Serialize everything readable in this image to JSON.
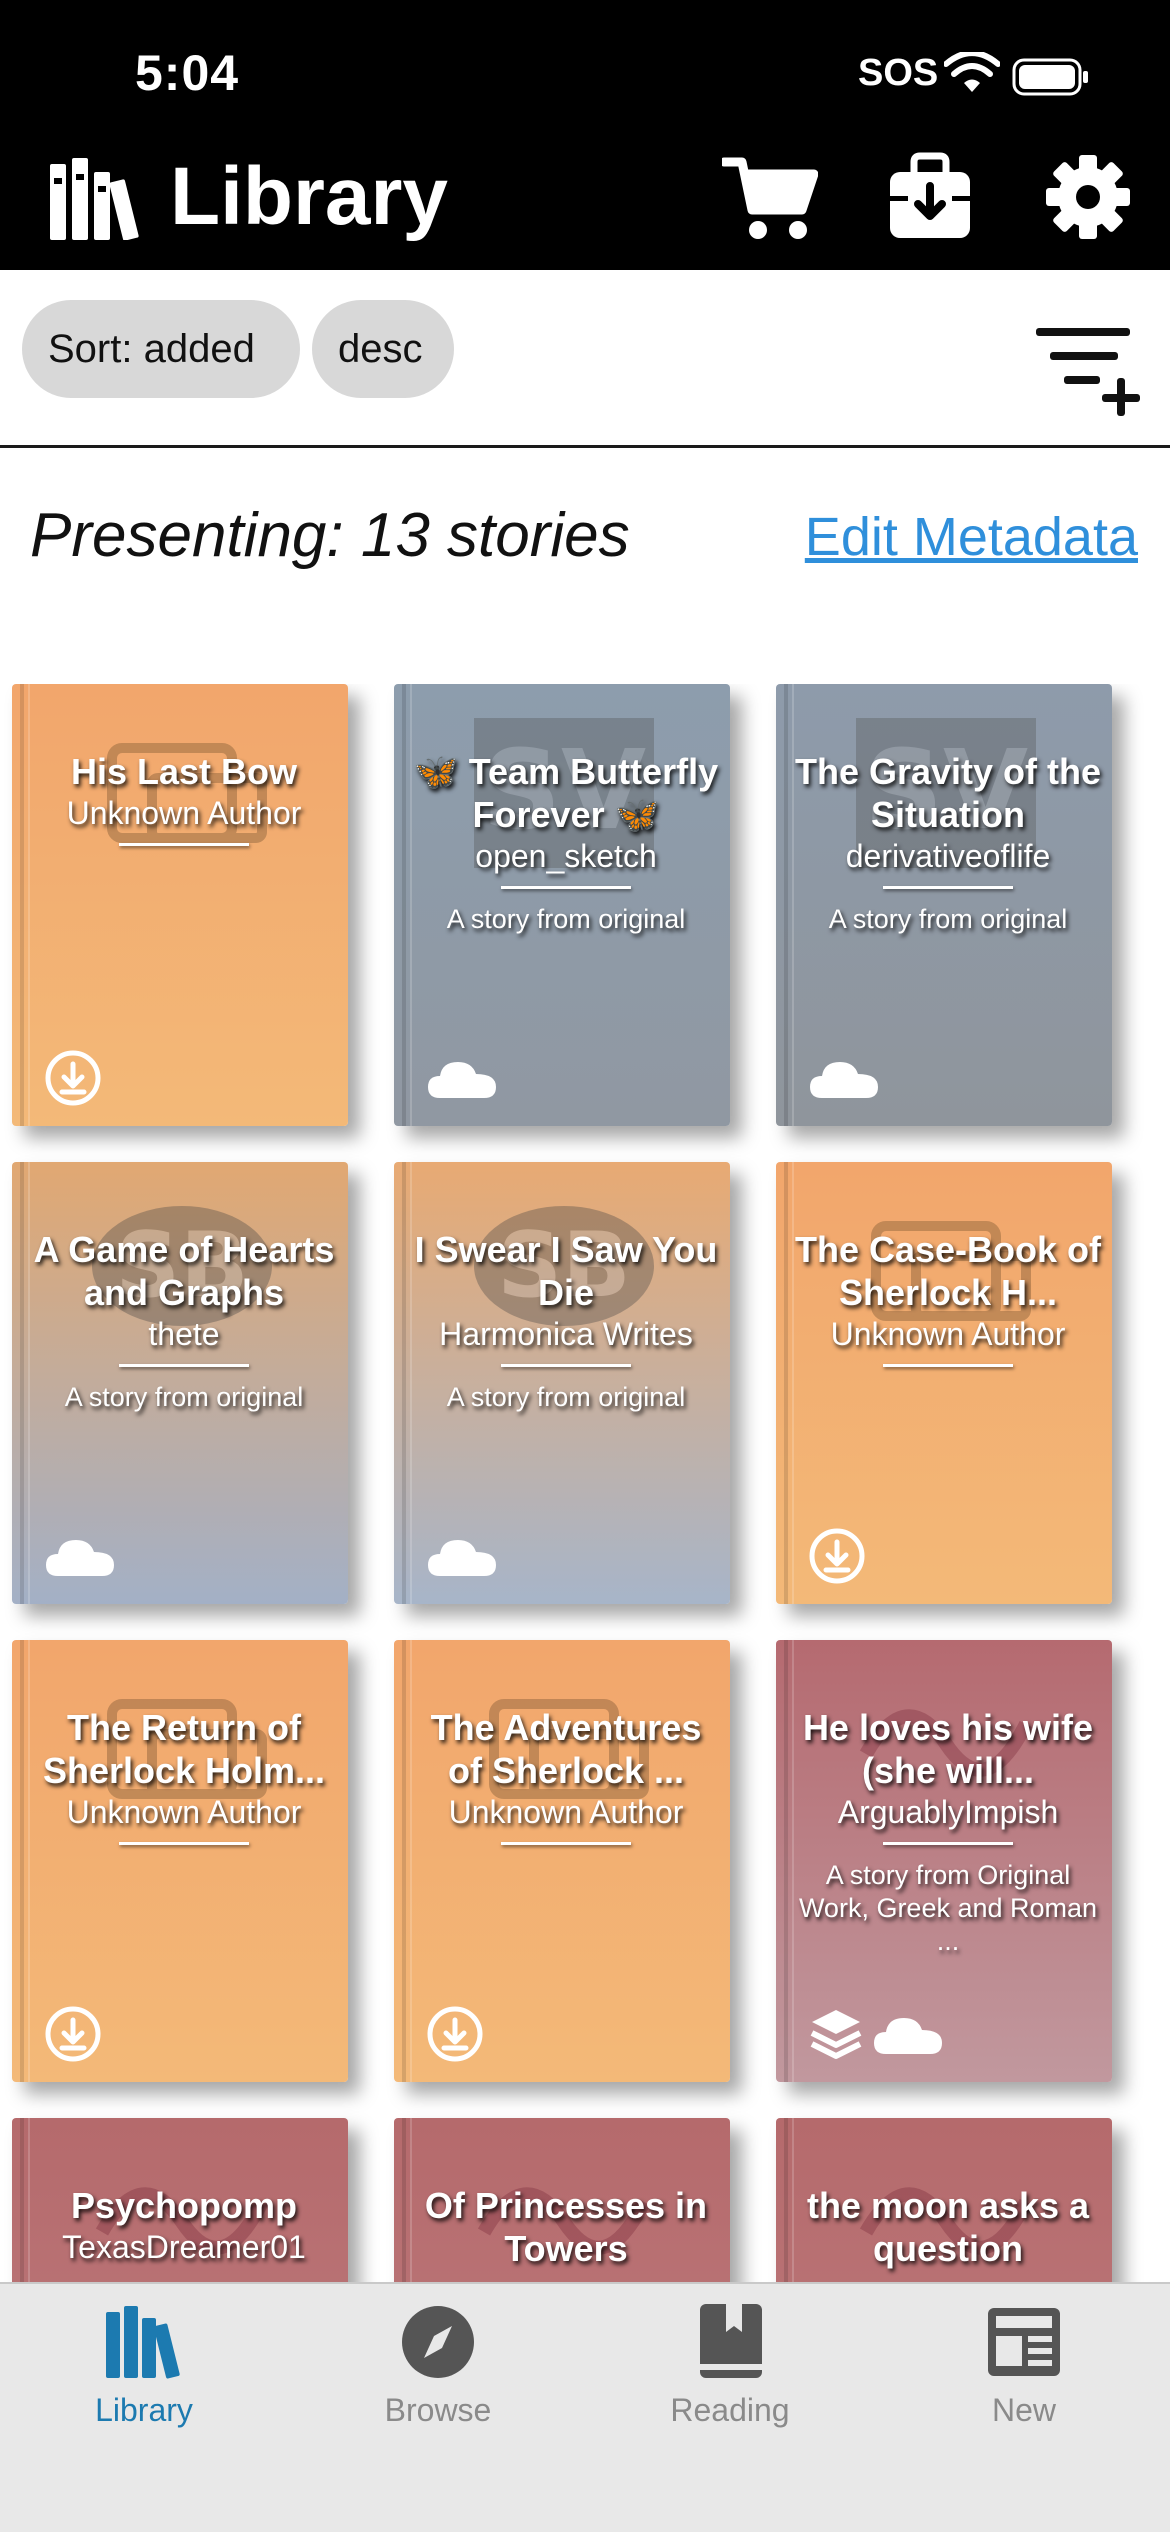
{
  "status": {
    "time": "5:04",
    "sos": "SOS"
  },
  "header": {
    "title": "Library",
    "icons": [
      "library-icon",
      "cart-icon",
      "download-bag-icon",
      "gear-icon"
    ]
  },
  "sort": {
    "sort_label": "Sort: added",
    "order_label": "desc"
  },
  "summary": {
    "presenting": "Presenting: 13 stories",
    "edit_metadata": "Edit Metadata"
  },
  "books": [
    {
      "title": "His Last Bow",
      "author": "Unknown Author",
      "desc": "",
      "status_icon": "download-icon",
      "color": "#f2a66c"
    },
    {
      "title": "🦋 Team Butterfly Forever 🦋",
      "author": "open_sketch",
      "desc": "A story from original",
      "status_icon": "cloud-icon",
      "color": "#8d9dad"
    },
    {
      "title": "The Gravity of the Situation",
      "author": "derivativeoflife",
      "desc": "A story from original",
      "status_icon": "cloud-icon",
      "color": "#8e9bab"
    },
    {
      "title": "A Game of Hearts and Graphs",
      "author": "thete",
      "desc": "A story from original",
      "status_icon": "cloud-icon",
      "color": "#e1a872"
    },
    {
      "title": "I Swear I Saw You Die",
      "author": "Harmonica Writes",
      "desc": "A story from original",
      "status_icon": "cloud-icon",
      "color": "#e8aa73"
    },
    {
      "title": "The Case-Book of Sherlock H...",
      "author": "Unknown Author",
      "desc": "",
      "status_icon": "download-icon",
      "color": "#f2a66c"
    },
    {
      "title": "The Return of Sherlock Holm...",
      "author": "Unknown Author",
      "desc": "",
      "status_icon": "download-icon",
      "color": "#f2a66c"
    },
    {
      "title": "The Adventures of Sherlock ...",
      "author": "Unknown Author",
      "desc": "",
      "status_icon": "download-icon",
      "color": "#f2a66c"
    },
    {
      "title": "He loves his wife (she will...",
      "author": "ArguablyImpish",
      "desc": "A story from Original Work, Greek and Roman ...",
      "status_icon": "layers-cloud-icon",
      "color": "#b56a70"
    },
    {
      "title": "Psychopomp",
      "author": "TexasDreamer01",
      "desc": "",
      "status_icon": "",
      "color": "#b56a6c"
    },
    {
      "title": "Of Princesses in Towers",
      "author": "",
      "desc": "",
      "status_icon": "",
      "color": "#b56a6c"
    },
    {
      "title": "the moon asks a question",
      "author": "",
      "desc": "",
      "status_icon": "",
      "color": "#b56a6c"
    }
  ],
  "tabs": [
    {
      "label": "Library",
      "icon": "library-icon",
      "active": true
    },
    {
      "label": "Browse",
      "icon": "compass-icon",
      "active": false
    },
    {
      "label": "Reading",
      "icon": "book-bookmark-icon",
      "active": false
    },
    {
      "label": "New",
      "icon": "newspaper-icon",
      "active": false
    }
  ],
  "colors": {
    "accent": "#2f8fdb",
    "tab_active": "#1c7ab0",
    "header_bg": "#000000"
  }
}
